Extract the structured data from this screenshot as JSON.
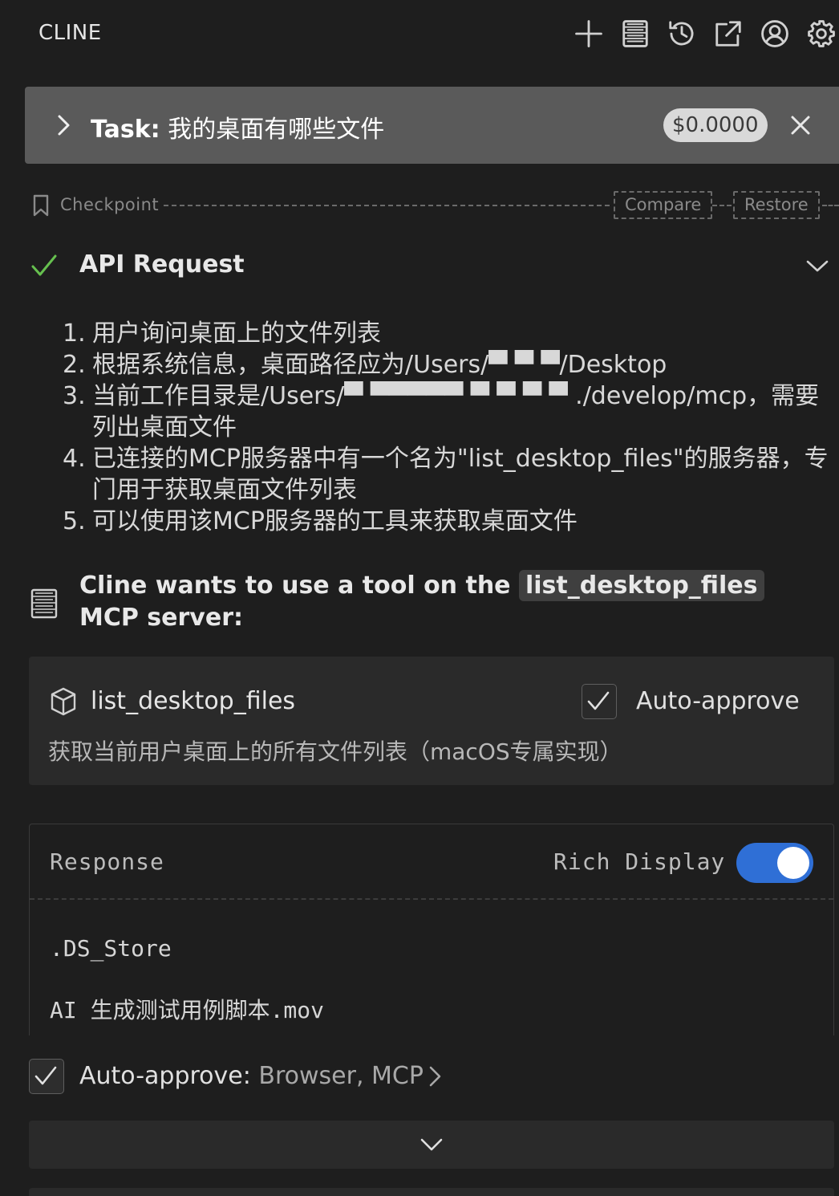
{
  "header": {
    "title": "CLINE",
    "icons": [
      "plus-icon",
      "mcp-servers-icon",
      "history-icon",
      "open-external-icon",
      "account-icon",
      "settings-icon"
    ]
  },
  "task": {
    "prefix": "Task:",
    "text": " 我的桌面有哪些文件",
    "cost": "$0.0000"
  },
  "checkpoint": {
    "label": "Checkpoint",
    "compare": "Compare",
    "restore": "Restore"
  },
  "api_request": {
    "title": "API Request",
    "status_color": "#66c04f"
  },
  "reasoning": [
    {
      "num": "1.",
      "text": "用户询问桌面上的文件列表"
    },
    {
      "num": "2.",
      "text": "根据系统信息，桌面路径应为/Users/▀ ▀ ▀/Desktop"
    },
    {
      "num": "3.",
      "text": "当前工作目录是/Users/▀ ▀▀▀▀▀ ▀ ▀ ▀ ▀ ./develop/mcp，需要列出桌面文件"
    },
    {
      "num": "4.",
      "text": "已连接的MCP服务器中有一个名为\"list_desktop_files\"的服务器，专门用于获取桌面文件列表"
    },
    {
      "num": "5.",
      "text": "可以使用该MCP服务器的工具来获取桌面文件"
    }
  ],
  "tool_use": {
    "prefix": "Cline wants to use a tool on the ",
    "server": "list_desktop_files",
    "suffix": " MCP server:"
  },
  "tool": {
    "name": "list_desktop_files",
    "auto_approve": "Auto-approve",
    "description": "获取当前用户桌面上的所有文件列表（macOS专属实现）"
  },
  "response": {
    "title": "Response",
    "rich_display": "Rich Display",
    "rich_display_on": true,
    "accent": "#2f6fd6",
    "lines": [
      ".DS_Store",
      "AI 生成测试用例脚本.mov"
    ]
  },
  "footer": {
    "auto_approve_label": "Auto-approve:",
    "auto_approve_value": " Browser, MCP"
  }
}
